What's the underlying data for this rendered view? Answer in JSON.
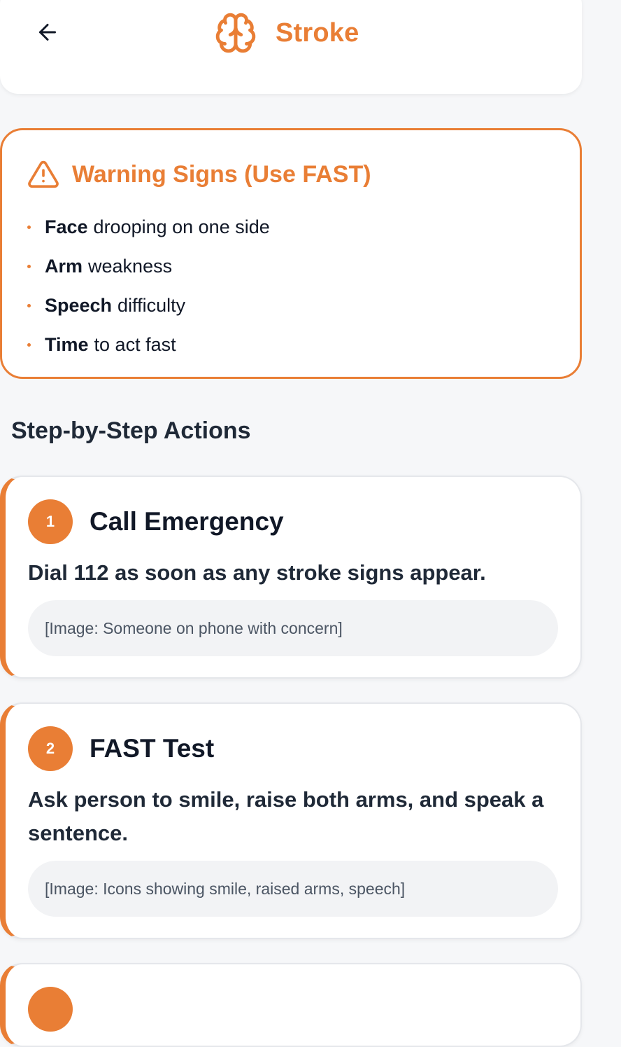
{
  "header": {
    "title": "Stroke",
    "back_icon": "arrow-left-icon",
    "title_icon": "brain-icon",
    "accent_color": "#e97e35"
  },
  "warning": {
    "icon": "warning-triangle-icon",
    "title": "Warning Signs (Use FAST)",
    "items": [
      {
        "bold": "Face",
        "text": "drooping on one side"
      },
      {
        "bold": "Arm",
        "text": "weakness"
      },
      {
        "bold": "Speech",
        "text": "difficulty"
      },
      {
        "bold": "Time",
        "text": "to act fast"
      }
    ]
  },
  "steps_section": {
    "title": "Step-by-Step Actions",
    "steps": [
      {
        "number": "1",
        "title": "Call Emergency",
        "description": "Dial 112 as soon as any stroke signs appear.",
        "image": "[Image: Someone on phone with concern]"
      },
      {
        "number": "2",
        "title": "FAST Test",
        "description": "Ask person to smile, raise both arms, and speak a sentence.",
        "image": "[Image: Icons showing smile, raised arms, speech]"
      }
    ]
  }
}
